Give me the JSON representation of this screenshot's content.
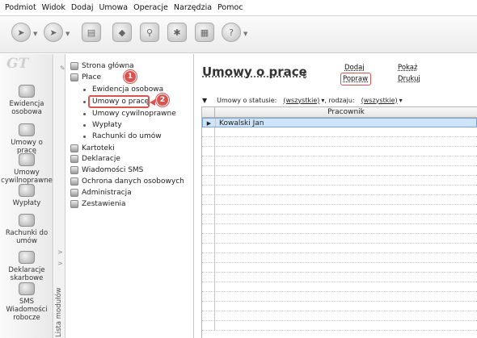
{
  "menu": [
    "Podmiot",
    "Widok",
    "Dodaj",
    "Umowa",
    "Operacje",
    "Narzędzia",
    "Pomoc"
  ],
  "logo": "GT",
  "modules": [
    {
      "label": "Ewidencja osobowa",
      "icon": "people-card-icon"
    },
    {
      "label": "Umowy o pracę",
      "icon": "contract-icon"
    },
    {
      "label": "Umowy cywilnoprawne",
      "icon": "civil-contract-icon"
    },
    {
      "label": "Wypłaty",
      "icon": "money-icon"
    },
    {
      "label": "Rachunki do umów",
      "icon": "invoice-icon"
    },
    {
      "label": "Deklaracje skarbowe",
      "icon": "declaration-icon"
    },
    {
      "label": "SMS Wiadomości robocze",
      "icon": "sms-phone-icon"
    }
  ],
  "modules_strip_label": "Lista modułów",
  "tree": {
    "items": [
      {
        "label": "Strona główna",
        "level": 0
      },
      {
        "label": "Płace",
        "level": 0
      },
      {
        "label": "Ewidencja osobowa",
        "level": 1
      },
      {
        "label": "Umowy o pracę",
        "level": 1
      },
      {
        "label": "Umowy cywilnoprawne",
        "level": 1
      },
      {
        "label": "Wypłaty",
        "level": 1
      },
      {
        "label": "Rachunki do umów",
        "level": 1
      },
      {
        "label": "Kartoteki",
        "level": 0
      },
      {
        "label": "Deklaracje",
        "level": 0
      },
      {
        "label": "Wiadomości SMS",
        "level": 0
      },
      {
        "label": "Ochrona danych osobowych",
        "level": 0
      },
      {
        "label": "Administracja",
        "level": 0
      },
      {
        "label": "Zestawienia",
        "level": 0
      }
    ],
    "badge1": "1",
    "badge2": "2"
  },
  "main": {
    "title": "Umowy o pracę",
    "links": {
      "dodaj": "Dodaj",
      "popraw": "Popraw",
      "pokaz": "Pokaż",
      "drukuj": "Drukuj"
    },
    "filter": {
      "status_label": "Umowy o statusie:",
      "status_value": "(wszystkie)",
      "rodzaj_label": ", rodzaju:",
      "rodzaj_value": "(wszystkie)"
    },
    "grid": {
      "column": "Pracownik",
      "rows": [
        "Kowalski Jan"
      ]
    }
  },
  "colors": {
    "highlight": "#d9534f",
    "selection": "#cfe4f8"
  }
}
